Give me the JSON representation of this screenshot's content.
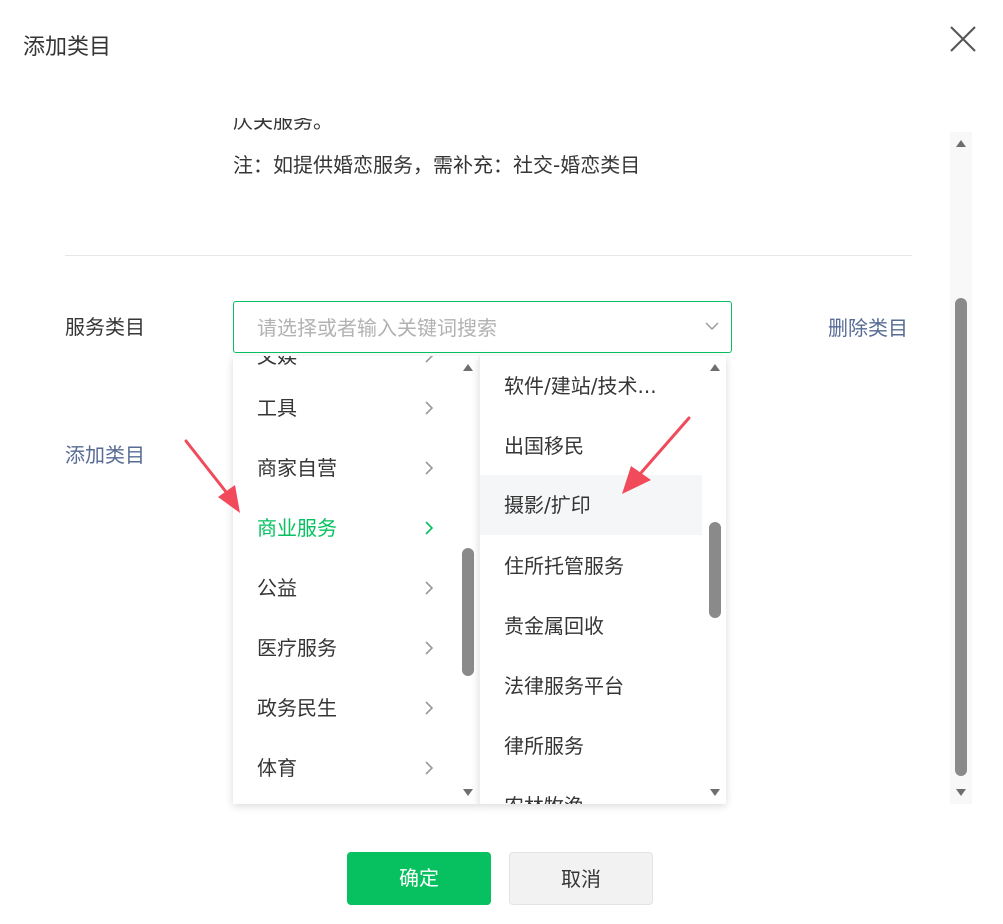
{
  "dialog": {
    "title": "添加类目",
    "note_partial": "仄关服务。",
    "note": "注：如提供婚恋服务，需补充：社交-婚恋类目"
  },
  "form": {
    "label": "服务类目",
    "placeholder": "请选择或者输入关键词搜索",
    "delete_label": "删除类目",
    "add_label": "添加类目"
  },
  "cascader": {
    "level1": {
      "partial_top": "文娱",
      "items": [
        "工具",
        "商家自营",
        "商业服务",
        "公益",
        "医疗服务",
        "政务民生",
        "体育"
      ],
      "active_index": 2
    },
    "level2": {
      "items": [
        "软件/建站/技术...",
        "出国移民",
        "摄影/扩印",
        "住所托管服务",
        "贵金属回收",
        "法律服务平台",
        "律所服务"
      ],
      "partial_bottom": "农林牧渔",
      "highlighted_index": 2
    }
  },
  "buttons": {
    "confirm": "确定",
    "cancel": "取消"
  },
  "colors": {
    "accent": "#07c160",
    "link": "#576b95",
    "annotation_arrow": "#f04a5b"
  }
}
